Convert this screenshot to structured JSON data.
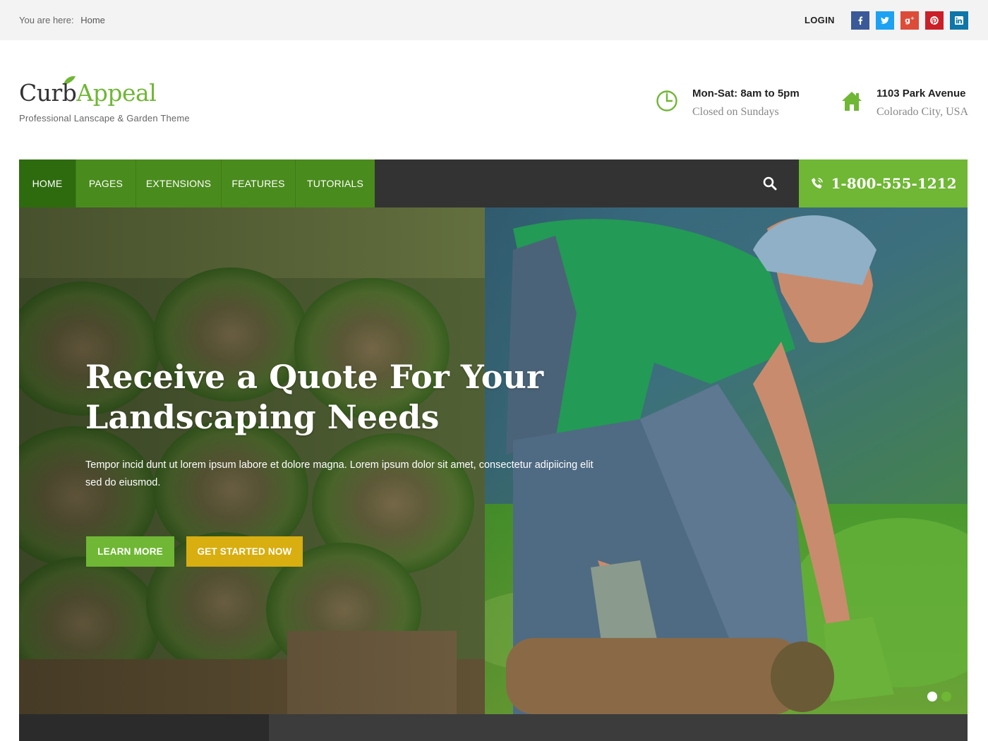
{
  "topbar": {
    "breadcrumb_prefix": "You are here:",
    "breadcrumb_home": "Home",
    "login_label": "LOGIN",
    "socials": [
      {
        "icon": "facebook-icon",
        "color": "#3b5998"
      },
      {
        "icon": "twitter-icon",
        "color": "#1da1f2"
      },
      {
        "icon": "google-plus-icon",
        "color": "#dd4b39"
      },
      {
        "icon": "pinterest-icon",
        "color": "#cb2027"
      },
      {
        "icon": "linkedin-icon",
        "color": "#0e76a8"
      }
    ]
  },
  "header": {
    "logo_part1": "Curb",
    "logo_part2": "Appeal",
    "tagline": "Professional Lanscape & Garden Theme",
    "hours_title": "Mon-Sat: 8am to 5pm",
    "hours_sub": "Closed on Sundays",
    "hours_icon": "clock-icon",
    "address_title": "1103 Park Avenue",
    "address_sub": "Colorado City, USA",
    "address_icon": "home-icon"
  },
  "nav": {
    "items": [
      {
        "label": "HOME",
        "active": true
      },
      {
        "label": "PAGES"
      },
      {
        "label": "EXTENSIONS"
      },
      {
        "label": "FEATURES"
      },
      {
        "label": "TUTORIALS"
      }
    ],
    "search_icon": "search-icon",
    "phone_icon": "phone-icon",
    "phone": "1-800-555-1212"
  },
  "hero": {
    "title_line1": "Receive a Quote For Your",
    "title_line2": "Landscaping Needs",
    "text": "Tempor incid dunt ut lorem ipsum labore et dolore magna. Lorem ipsum dolor sit amet, consectetur adipiicing elit sed do eiusmod.",
    "learn_more": "LEARN MORE",
    "get_started": "GET STARTED NOW",
    "slides": 2,
    "active_slide": 2
  },
  "colors": {
    "brand_green": "#6fb734",
    "nav_green": "#4a8b1d",
    "nav_active": "#2e6b0f",
    "cta_yellow": "#d8ae10",
    "dark": "#333333"
  }
}
